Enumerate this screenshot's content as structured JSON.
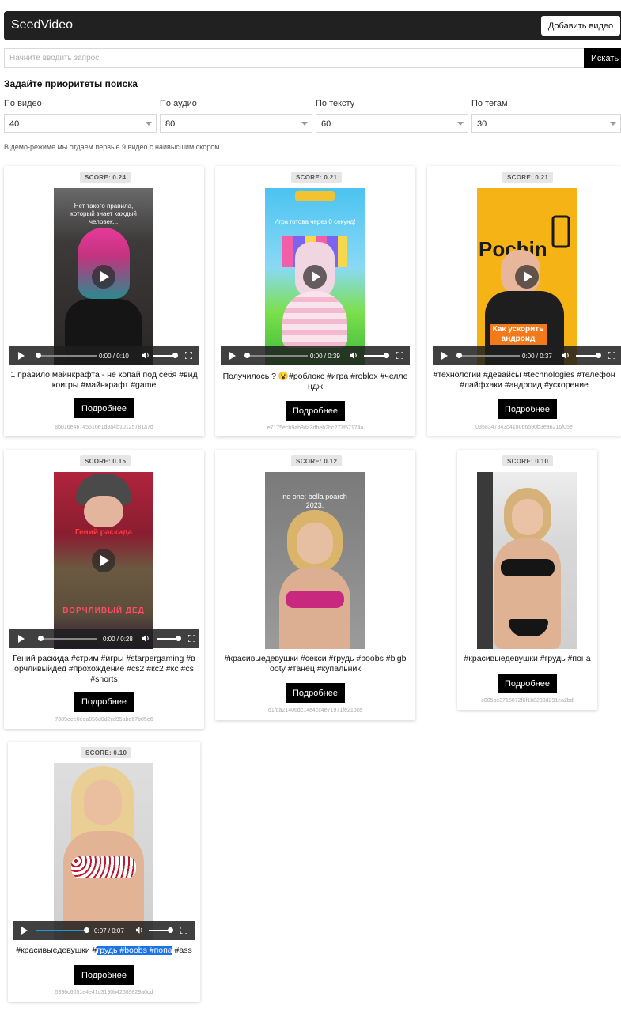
{
  "app": {
    "title": "SeedVideo",
    "add_video_label": "Добавить видео"
  },
  "search": {
    "placeholder": "Начните вводить запрос",
    "button_label": "Искать"
  },
  "priorities": {
    "title": "Задайте приоритеты поиска",
    "fields": [
      {
        "label": "По видео",
        "value": "40"
      },
      {
        "label": "По аудио",
        "value": "80"
      },
      {
        "label": "По тексту",
        "value": "60"
      },
      {
        "label": "По тегам",
        "value": "30"
      }
    ]
  },
  "demo_note": "В демо-режиме мы отдаем первые 9 видео с наивысшим скором.",
  "more_label": "Подробнее",
  "cards": [
    {
      "score": "SCORE: 0.24",
      "caption": "Нет такого правила, который знает каждый человек...",
      "time": "0:00 / 0:10",
      "tags": "1 правило майнкрафта - не копай под себя #вид",
      "tags2": "коигры #майнкрафт #game",
      "hash": "8b016e46745516e1d9a4b10125781a7d"
    },
    {
      "score": "SCORE: 0.21",
      "caption": "Игра готова через 0 секунд!",
      "time": "0:00 / 0:39",
      "tags": "Получилось ? 😮#роблокс #игра #roblox #челле",
      "tags2": "ндж",
      "hash": "e7175ecb9ab3da3dbeb2bc277f57174a"
    },
    {
      "score": "SCORE: 0.21",
      "caption": "Как ускорить андроид",
      "time": "0:00 / 0:37",
      "tags": "#технологии #девайсы #technologies #телефон",
      "tags2": "#лайфхаки #андроид #ускорение",
      "hash": "0358347343d4180d6590b3ea6216f05e"
    },
    {
      "score": "SCORE: 0.15",
      "caption": "Гений раскида",
      "time": "0:00 / 0:28",
      "tags": "Гений раскида #стрим #игры #starpergaming #в",
      "tags2": "орчливыйдед #прохождение #cs2 #кс2 #кс #cs",
      "tags3": "#shorts",
      "hash": "7309eee0eea856d0d2cd95abd67b05e6"
    },
    {
      "score": "SCORE: 0.12",
      "caption": "no one: bella poarch 2023:",
      "tags": "#красивыедевушки #секси #грудь #boobs #bigb",
      "tags2": "ooty #танец #купальник",
      "hash": "d1fda21406dc14e4cc4e71971fe21bce"
    },
    {
      "score": "SCORE: 0.10",
      "tags": "#красивыедевушки #грудь #пона",
      "hash": "c005be3715072f6f1b8238d291ea2bd"
    },
    {
      "score": "SCORE: 0.10",
      "time": "0:07 / 0:07",
      "tags_pre": "#красивыедевушки #",
      "tags_hl": "грудь #boobs #попа",
      "tags_post": " #ass",
      "hash": "5396c6051e4e41d3190b42689829a0cd"
    }
  ]
}
